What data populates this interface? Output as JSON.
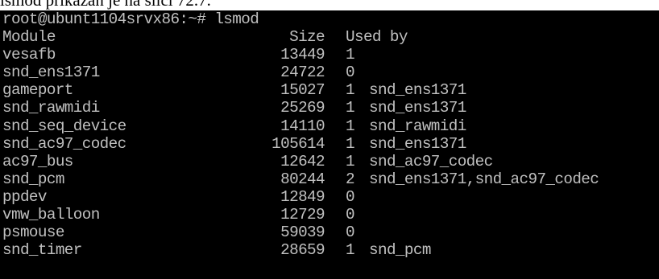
{
  "caption": "lsmod prikazan je na slici 72.7.",
  "terminal": {
    "prompt": "root@ubunt1104srvx86:~#",
    "command": "lsmod",
    "headers": {
      "module": "Module",
      "size": "Size",
      "used_by": "Used by"
    },
    "rows": [
      {
        "module": "vesafb",
        "size": "13449",
        "count": "1",
        "used_by": ""
      },
      {
        "module": "snd_ens1371",
        "size": "24722",
        "count": "0",
        "used_by": ""
      },
      {
        "module": "gameport",
        "size": "15027",
        "count": "1",
        "used_by": "snd_ens1371"
      },
      {
        "module": "snd_rawmidi",
        "size": "25269",
        "count": "1",
        "used_by": "snd_ens1371"
      },
      {
        "module": "snd_seq_device",
        "size": "14110",
        "count": "1",
        "used_by": "snd_rawmidi"
      },
      {
        "module": "snd_ac97_codec",
        "size": "105614",
        "count": "1",
        "used_by": "snd_ens1371"
      },
      {
        "module": "ac97_bus",
        "size": "12642",
        "count": "1",
        "used_by": "snd_ac97_codec"
      },
      {
        "module": "snd_pcm",
        "size": "80244",
        "count": "2",
        "used_by": "snd_ens1371,snd_ac97_codec"
      },
      {
        "module": "ppdev",
        "size": "12849",
        "count": "0",
        "used_by": ""
      },
      {
        "module": "vmw_balloon",
        "size": "12729",
        "count": "0",
        "used_by": ""
      },
      {
        "module": "psmouse",
        "size": "59039",
        "count": "0",
        "used_by": ""
      },
      {
        "module": "snd_timer",
        "size": "28659",
        "count": "1",
        "used_by": "snd_pcm"
      }
    ],
    "colors": {
      "background": "#000000",
      "text": "#c0c0c0"
    }
  }
}
